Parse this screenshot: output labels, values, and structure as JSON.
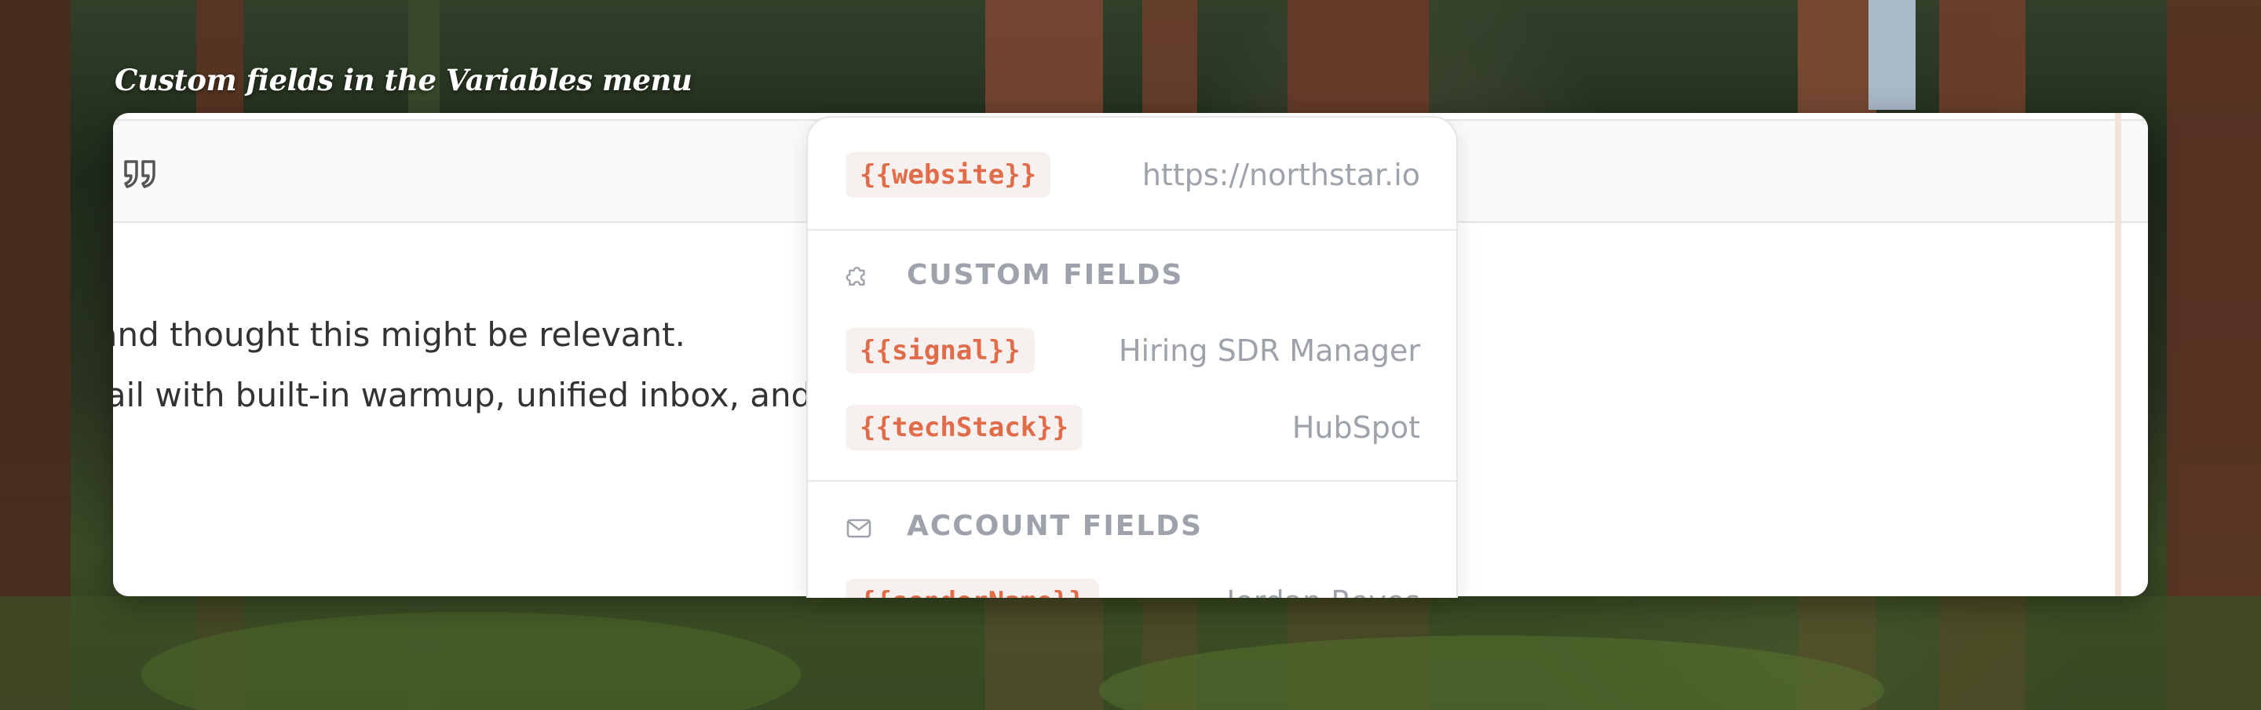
{
  "caption": "Custom fields in the Variables menu",
  "editor": {
    "line1": "t and thought this might be relevant.",
    "line2": "mail with built-in warmup, unified inbox, and re"
  },
  "dropdown": {
    "top_row": {
      "token": "{{website}}",
      "value": "https://northstar.io"
    },
    "sections": [
      {
        "title": "CUSTOM FIELDS",
        "icon": "puzzle-icon",
        "rows": [
          {
            "token": "{{signal}}",
            "value": "Hiring SDR Manager"
          },
          {
            "token": "{{techStack}}",
            "value": "HubSpot"
          }
        ]
      },
      {
        "title": "ACCOUNT FIELDS",
        "icon": "mail-icon",
        "rows": [
          {
            "token": "{{senderName}}",
            "value": "Jordan Reyes"
          }
        ]
      }
    ]
  },
  "colors": {
    "token_text": "#e06c4a",
    "token_bg": "#f6f1ef",
    "muted": "#9ea3ab"
  }
}
